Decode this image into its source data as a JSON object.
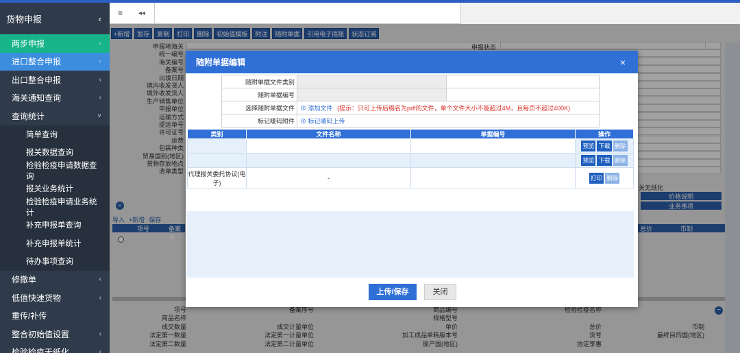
{
  "sidebar": {
    "title": "货物申报",
    "items": [
      {
        "label": "两步申报",
        "chev": "‹",
        "style": "green"
      },
      {
        "label": "进口整合申报",
        "chev": "‹",
        "style": "blue"
      },
      {
        "label": "出口整合申报",
        "chev": "‹",
        "style": ""
      },
      {
        "label": "海关通知查询",
        "chev": "‹",
        "style": ""
      },
      {
        "label": "查询统计",
        "chev": "˅",
        "style": ""
      },
      {
        "label": "简单查询",
        "chev": "",
        "style": "sub"
      },
      {
        "label": "报关数据查询",
        "chev": "",
        "style": "sub"
      },
      {
        "label": "检验检疫申请数据查询",
        "chev": "",
        "style": "sub"
      },
      {
        "label": "报关业务统计",
        "chev": "",
        "style": "sub"
      },
      {
        "label": "检验检疫申请业务统计",
        "chev": "",
        "style": "sub"
      },
      {
        "label": "补充申报单查询",
        "chev": "",
        "style": "sub"
      },
      {
        "label": "补充申报单统计",
        "chev": "",
        "style": "sub"
      },
      {
        "label": "待办事项查询",
        "chev": "",
        "style": "sub"
      },
      {
        "label": "修撤单",
        "chev": "‹",
        "style": ""
      },
      {
        "label": "低值快速货物",
        "chev": "‹",
        "style": ""
      },
      {
        "label": "重传/补传",
        "chev": "",
        "style": ""
      },
      {
        "label": "整合初始值设置",
        "chev": "‹",
        "style": ""
      },
      {
        "label": "检验检疫无纸化",
        "chev": "‹",
        "style": ""
      }
    ]
  },
  "topbar": {
    "menu_icon": "≡",
    "back_icon": "◂◂"
  },
  "toolbar": [
    "+新增",
    "暂存",
    "复制",
    "打印",
    "删除",
    "初始值模板",
    "附注",
    "随附单据",
    "引用电子底账",
    "状态订阅"
  ],
  "background": {
    "labels": [
      "申报地海关",
      "统一编号",
      "海关编号",
      "备案号",
      "出境日期",
      "境内收发货人",
      "境外收发货人",
      "生产销售单位",
      "申报单位",
      "运输方式",
      "提运单号",
      "许可证号",
      "运费",
      "包装种类",
      "贸易国别(地区)",
      "货物存放地点",
      "清单类型"
    ],
    "status_label": "申报状态",
    "right_buttons": [
      "价格说明",
      "业务事项"
    ],
    "right_text": "关无纸化",
    "list_toolbar": [
      "导入",
      "+新增",
      "保存"
    ],
    "list_headers": [
      "项号",
      "备案序"
    ],
    "list_right_headers": [
      "总价",
      "币制"
    ],
    "bottom_rows": [
      [
        "项号",
        "备案序号",
        "商品编号",
        "检验检疫名称"
      ],
      [
        "商品名称",
        "",
        "规格型号",
        ""
      ],
      [
        "成交数量",
        "成交计量单位",
        "单价",
        "总价",
        "币制"
      ],
      [
        "法定第一数量",
        "法定第一计量单位",
        "加工成品单耗版本号",
        "货号",
        "最终目的国(地区)"
      ],
      [
        "法定第二数量",
        "法定第二计量单位",
        "原产国(地区)",
        "协定享惠"
      ]
    ],
    "tips": "tips"
  },
  "modal": {
    "title": "随附单据编辑",
    "close": "×",
    "form": {
      "doc_type_label": "随附单据文件类别",
      "doc_no_label": "随附单据编号",
      "select_file_label": "选择随附单据文件",
      "add_file": "添加文件",
      "hint": "(提示：只可上传后缀名为pdf的文件，单个文件大小不能超过4M，且每页不超过400K)",
      "mark_label": "标记唛码附件",
      "mark_upload": "标记唛码上传"
    },
    "table": {
      "headers": [
        "类别",
        "文件名称",
        "单据编号",
        "操作"
      ],
      "rows": [
        {
          "category": "",
          "filename": "",
          "docno": "",
          "actions": [
            "预览",
            "下载",
            "删除"
          ]
        },
        {
          "category": "",
          "filename": "",
          "docno": "",
          "actions": [
            "预览",
            "下载",
            "删除"
          ]
        },
        {
          "category": "代理报关委托协议(电子)",
          "filename": "-",
          "docno": "",
          "actions": [
            "打印",
            "删除"
          ]
        }
      ]
    },
    "upload_button": "上传/保存",
    "close_button": "关闭"
  }
}
